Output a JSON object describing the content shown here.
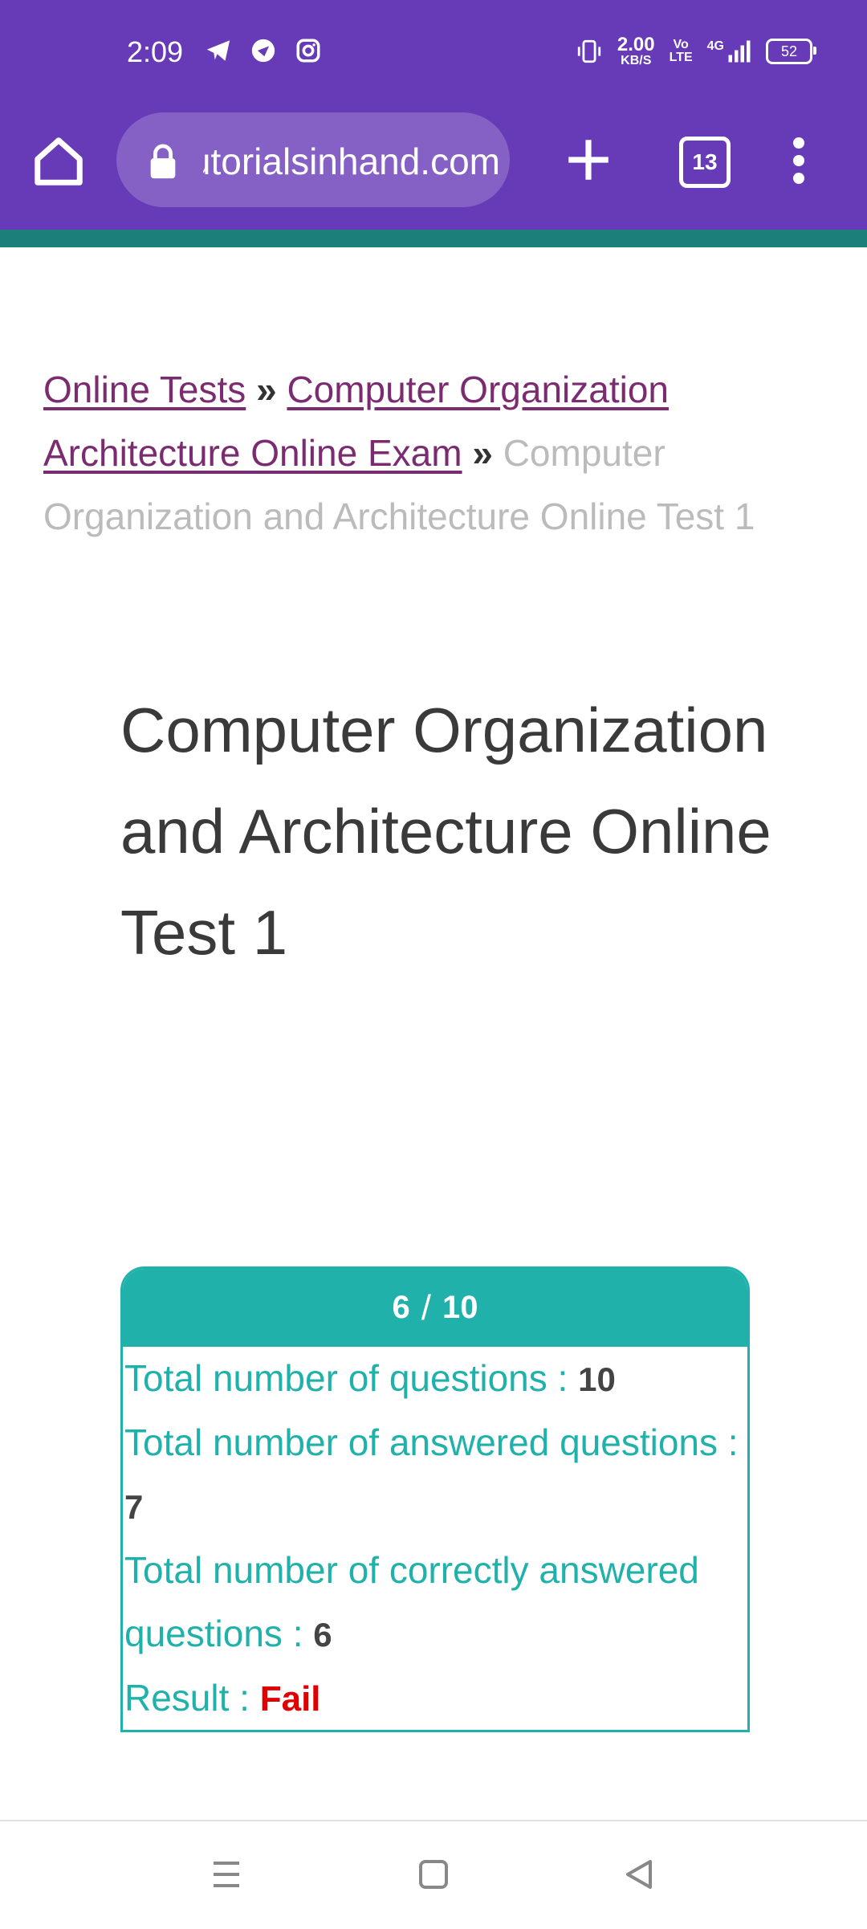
{
  "status_bar": {
    "time": "2:09",
    "left_icons": [
      "telegram-icon",
      "browser-notification-icon",
      "instagram-icon"
    ],
    "speed_value": "2.00",
    "speed_unit": "KB/S",
    "volte_top": "Vo",
    "volte_bottom": "LTE",
    "network": "4G",
    "battery": "52"
  },
  "browser": {
    "url": "tutorialsinhand.com",
    "tab_count": "13",
    "toolbar_color": "#673ab7",
    "accent_color": "#1d7f7a"
  },
  "breadcrumb": {
    "items": [
      "Online Tests",
      "Computer Organization Architecture Online Exam",
      "Computer Organization and Architecture Online Test 1"
    ],
    "separator": "»"
  },
  "page": {
    "title": "Computer Organization and Architecture Online Test 1"
  },
  "result": {
    "score": "6",
    "slash": "/",
    "total": "10",
    "total_questions_label": "Total number of questions :",
    "total_questions_value": "10",
    "answered_label": "Total number of answered questions :",
    "answered_value": "7",
    "correct_label": "Total number of correctly answered questions :",
    "correct_value": "6",
    "result_label": "Result :",
    "result_value": "Fail",
    "accent_color": "#20b2aa",
    "fail_color": "#e00000"
  },
  "navbar": {
    "buttons": [
      "menu-icon",
      "home-square-icon",
      "back-icon"
    ]
  }
}
